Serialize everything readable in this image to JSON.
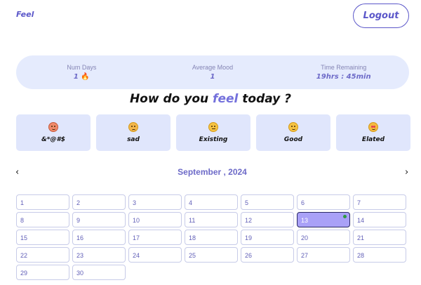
{
  "header": {
    "brand": "Feel",
    "logout_label": "Logout"
  },
  "stats": [
    {
      "label": "Num Days",
      "value": "1",
      "icon": "fire-icon"
    },
    {
      "label": "Average Mood",
      "value": "1"
    },
    {
      "label": "Time Remaining",
      "value": "19hrs : 45min"
    }
  ],
  "prompt": {
    "before": "How do you ",
    "accent": "feel",
    "after": " today ?"
  },
  "moods": [
    {
      "label": "&*@#$",
      "icon": "crying-face-icon"
    },
    {
      "label": "sad",
      "icon": "sad-face-icon"
    },
    {
      "label": "Existing",
      "icon": "neutral-face-icon"
    },
    {
      "label": "Good",
      "icon": "smiling-face-icon"
    },
    {
      "label": "Elated",
      "icon": "heart-eyes-face-icon"
    }
  ],
  "calendar": {
    "title": "September , 2024",
    "prev_glyph": "‹",
    "next_glyph": "›",
    "selected_day": "13",
    "days": [
      "1",
      "2",
      "3",
      "4",
      "5",
      "6",
      "7",
      "8",
      "9",
      "10",
      "11",
      "12",
      "13",
      "14",
      "15",
      "16",
      "17",
      "18",
      "19",
      "20",
      "21",
      "22",
      "23",
      "24",
      "25",
      "26",
      "27",
      "28",
      "29",
      "30"
    ]
  },
  "colors": {
    "accent": "#5b57c9",
    "panel": "#e5ebfd",
    "selected": "#a9a1f7",
    "dot": "#2e9a3f"
  }
}
